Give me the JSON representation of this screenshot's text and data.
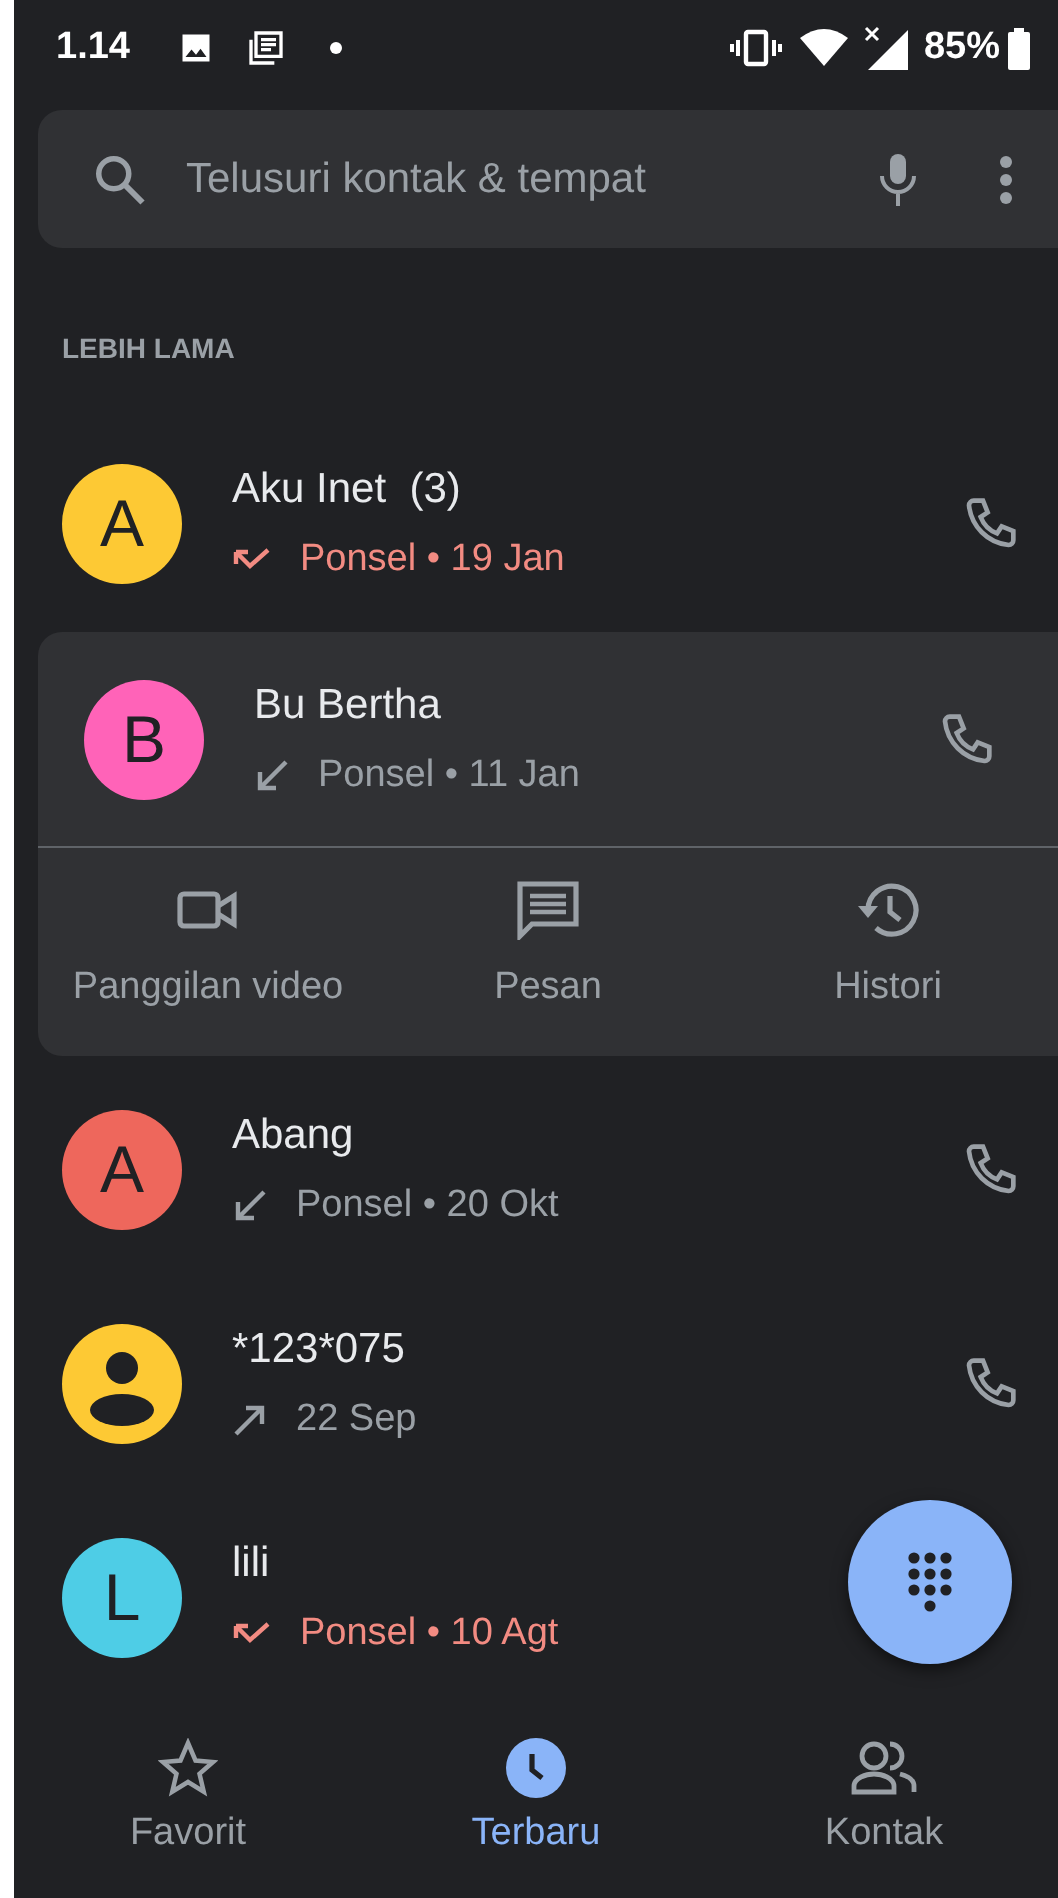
{
  "status_bar": {
    "time": "1.14",
    "battery_text": "85%"
  },
  "search": {
    "placeholder": "Telusuri kontak & tempat"
  },
  "section_header": "LEBIH LAMA",
  "calls": [
    {
      "avatar": {
        "kind": "letter",
        "initial": "A",
        "color": "#fdc934"
      },
      "name": "Aku Inet  (3)",
      "direction": {
        "kind": "missed"
      },
      "detail": "Ponsel • 19 Jan",
      "expanded": false
    },
    {
      "avatar": {
        "kind": "letter",
        "initial": "B",
        "color": "#ff63b8"
      },
      "name": "Bu Bertha",
      "direction": {
        "kind": "incoming"
      },
      "detail": "Ponsel • 11 Jan",
      "expanded": true,
      "actions": [
        {
          "kind": "video",
          "label": "Panggilan video"
        },
        {
          "kind": "message",
          "label": "Pesan"
        },
        {
          "kind": "history",
          "label": "Histori"
        }
      ]
    },
    {
      "avatar": {
        "kind": "letter",
        "initial": "A",
        "color": "#ee675c"
      },
      "name": "Abang",
      "direction": {
        "kind": "incoming"
      },
      "detail": "Ponsel • 20 Okt",
      "expanded": false
    },
    {
      "avatar": {
        "kind": "person",
        "color": "#fdc934"
      },
      "name": "*123*075",
      "direction": {
        "kind": "outgoing"
      },
      "detail": "22 Sep",
      "expanded": false
    },
    {
      "avatar": {
        "kind": "letter",
        "initial": "L",
        "color": "#4ecde6"
      },
      "name": "lili",
      "direction": {
        "kind": "missed"
      },
      "detail": "Ponsel • 10 Agt",
      "expanded": false
    }
  ],
  "nav": [
    {
      "kind": "star",
      "label": "Favorit",
      "selected": false
    },
    {
      "kind": "clock",
      "label": "Terbaru",
      "selected": true
    },
    {
      "kind": "people",
      "label": "Kontak",
      "selected": false
    }
  ]
}
